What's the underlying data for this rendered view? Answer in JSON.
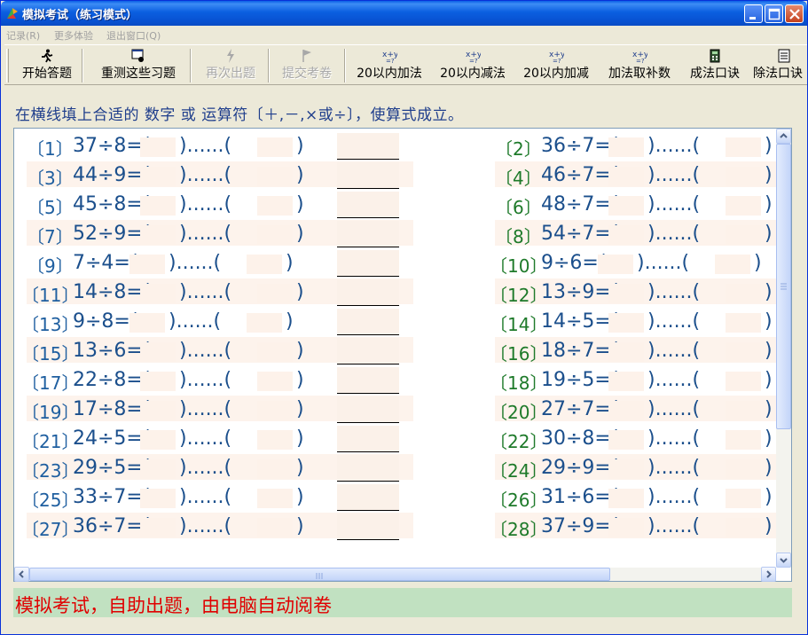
{
  "window": {
    "title": "模拟考试（练习模式）"
  },
  "menu": [
    {
      "label": "记录(R)"
    },
    {
      "label": "更多体验"
    },
    {
      "label": "退出窗口(Q)"
    }
  ],
  "toolbar": [
    {
      "label": "开始答题",
      "icon": "runner-icon",
      "enabled": true
    },
    {
      "label": "重测这些习题",
      "icon": "retest-icon",
      "enabled": true
    },
    {
      "label": "再次出题",
      "icon": "lightning-icon",
      "enabled": false
    },
    {
      "label": "提交考卷",
      "icon": "flag-icon",
      "enabled": false
    },
    {
      "label": "20以内加法",
      "icon": "xy-icon",
      "enabled": true
    },
    {
      "label": "20以内减法",
      "icon": "xy-icon",
      "enabled": true
    },
    {
      "label": "20以内加减",
      "icon": "xy-icon",
      "enabled": true
    },
    {
      "label": "加法取补数",
      "icon": "xy-icon",
      "enabled": true
    },
    {
      "label": "成法口诀",
      "icon": "calculator-icon",
      "enabled": true
    },
    {
      "label": "除法口诀",
      "icon": "document-icon",
      "enabled": true
    }
  ],
  "instruction": "在横线填上合适的 数字 或 运算符〔＋,－,×或÷〕，使算式成立。",
  "problems": [
    {
      "num": "〔1〕",
      "expr": "37÷8=(",
      "mid": ")......(",
      "end": ")"
    },
    {
      "num": "〔2〕",
      "expr": "36÷7=(",
      "mid": ")......(",
      "end": ")"
    },
    {
      "num": "〔3〕",
      "expr": "44÷9=(",
      "mid": ")......(",
      "end": ")"
    },
    {
      "num": "〔4〕",
      "expr": "46÷7=(",
      "mid": ")......(",
      "end": ")"
    },
    {
      "num": "〔5〕",
      "expr": "45÷8=(",
      "mid": ")......(",
      "end": ")"
    },
    {
      "num": "〔6〕",
      "expr": "48÷7=(",
      "mid": ")......(",
      "end": ")"
    },
    {
      "num": "〔7〕",
      "expr": "52÷9=(",
      "mid": ")......(",
      "end": ")"
    },
    {
      "num": "〔8〕",
      "expr": "54÷7=(",
      "mid": ")......(",
      "end": ")"
    },
    {
      "num": "〔9〕",
      "expr": "7÷4=(",
      "mid": ")......(",
      "end": ")"
    },
    {
      "num": "〔10〕",
      "expr": "9÷6=(",
      "mid": ")......(",
      "end": ")"
    },
    {
      "num": "〔11〕",
      "expr": "14÷8=(",
      "mid": ")......(",
      "end": ")"
    },
    {
      "num": "〔12〕",
      "expr": "13÷9=(",
      "mid": ")......(",
      "end": ")"
    },
    {
      "num": "〔13〕",
      "expr": "9÷8=(",
      "mid": ")......(",
      "end": ")"
    },
    {
      "num": "〔14〕",
      "expr": "14÷5=(",
      "mid": ")......(",
      "end": ")"
    },
    {
      "num": "〔15〕",
      "expr": "13÷6=(",
      "mid": ")......(",
      "end": ")"
    },
    {
      "num": "〔16〕",
      "expr": "18÷7=(",
      "mid": ")......(",
      "end": ")"
    },
    {
      "num": "〔17〕",
      "expr": "22÷8=(",
      "mid": ")......(",
      "end": ")"
    },
    {
      "num": "〔18〕",
      "expr": "19÷5=(",
      "mid": ")......(",
      "end": ")"
    },
    {
      "num": "〔19〕",
      "expr": "17÷8=(",
      "mid": ")......(",
      "end": ")"
    },
    {
      "num": "〔20〕",
      "expr": "27÷7=(",
      "mid": ")......(",
      "end": ")"
    },
    {
      "num": "〔21〕",
      "expr": "24÷5=(",
      "mid": ")......(",
      "end": ")"
    },
    {
      "num": "〔22〕",
      "expr": "30÷8=(",
      "mid": ")......(",
      "end": ")"
    },
    {
      "num": "〔23〕",
      "expr": "29÷5=(",
      "mid": ")......(",
      "end": ")"
    },
    {
      "num": "〔24〕",
      "expr": "29÷9=(",
      "mid": ")......(",
      "end": ")"
    },
    {
      "num": "〔25〕",
      "expr": "33÷7=(",
      "mid": ")......(",
      "end": ")"
    },
    {
      "num": "〔26〕",
      "expr": "31÷6=(",
      "mid": ")......(",
      "end": ")"
    },
    {
      "num": "〔27〕",
      "expr": "36÷7=(",
      "mid": ")......(",
      "end": ")"
    },
    {
      "num": "〔28〕",
      "expr": "37÷9=(",
      "mid": ")......(",
      "end": ")"
    }
  ],
  "status": "模拟考试，自助出题，由电脑自动阅卷",
  "colors": {
    "title_bar": "#0A5FE6",
    "problem_text": "#1B4F8C",
    "right_number": "#1E7A2A",
    "status_bg": "#C1E1C1",
    "status_text": "#E00000"
  }
}
